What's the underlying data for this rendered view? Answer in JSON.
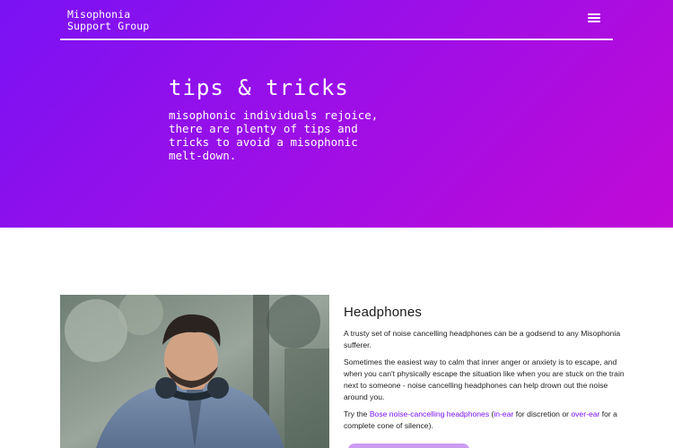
{
  "header": {
    "brand_line1": "Misophonia",
    "brand_line2": "Support Group",
    "menu_icon": "hamburger-menu-icon"
  },
  "hero": {
    "title": "tips & tricks",
    "subtitle": "misophonic individuals rejoice, there are plenty of tips and tricks to avoid a misophonic melt-down."
  },
  "section": {
    "heading": "Headphones",
    "p1": "A trusty set of noise cancelling headphones can be a godsend to any Misophonia sufferer.",
    "p2": "Sometimes the easiest way to calm that inner anger or anxiety is to escape, and when you can't physically escape the situation like when you are stuck on the train next to someone - noise cancelling headphones can help drown out the noise around you.",
    "p3_prefix": "Try the ",
    "p3_link1": "Bose noise-cancelling headphones",
    "p3_mid1": " (",
    "p3_link2": "in-ear",
    "p3_mid2": " for discretion or ",
    "p3_link3": "over-ear",
    "p3_suffix": " for a complete cone of silence)."
  },
  "colors": {
    "gradient_start": "#7a12f4",
    "gradient_end": "#c10ad6",
    "link": "#7a12f4"
  }
}
